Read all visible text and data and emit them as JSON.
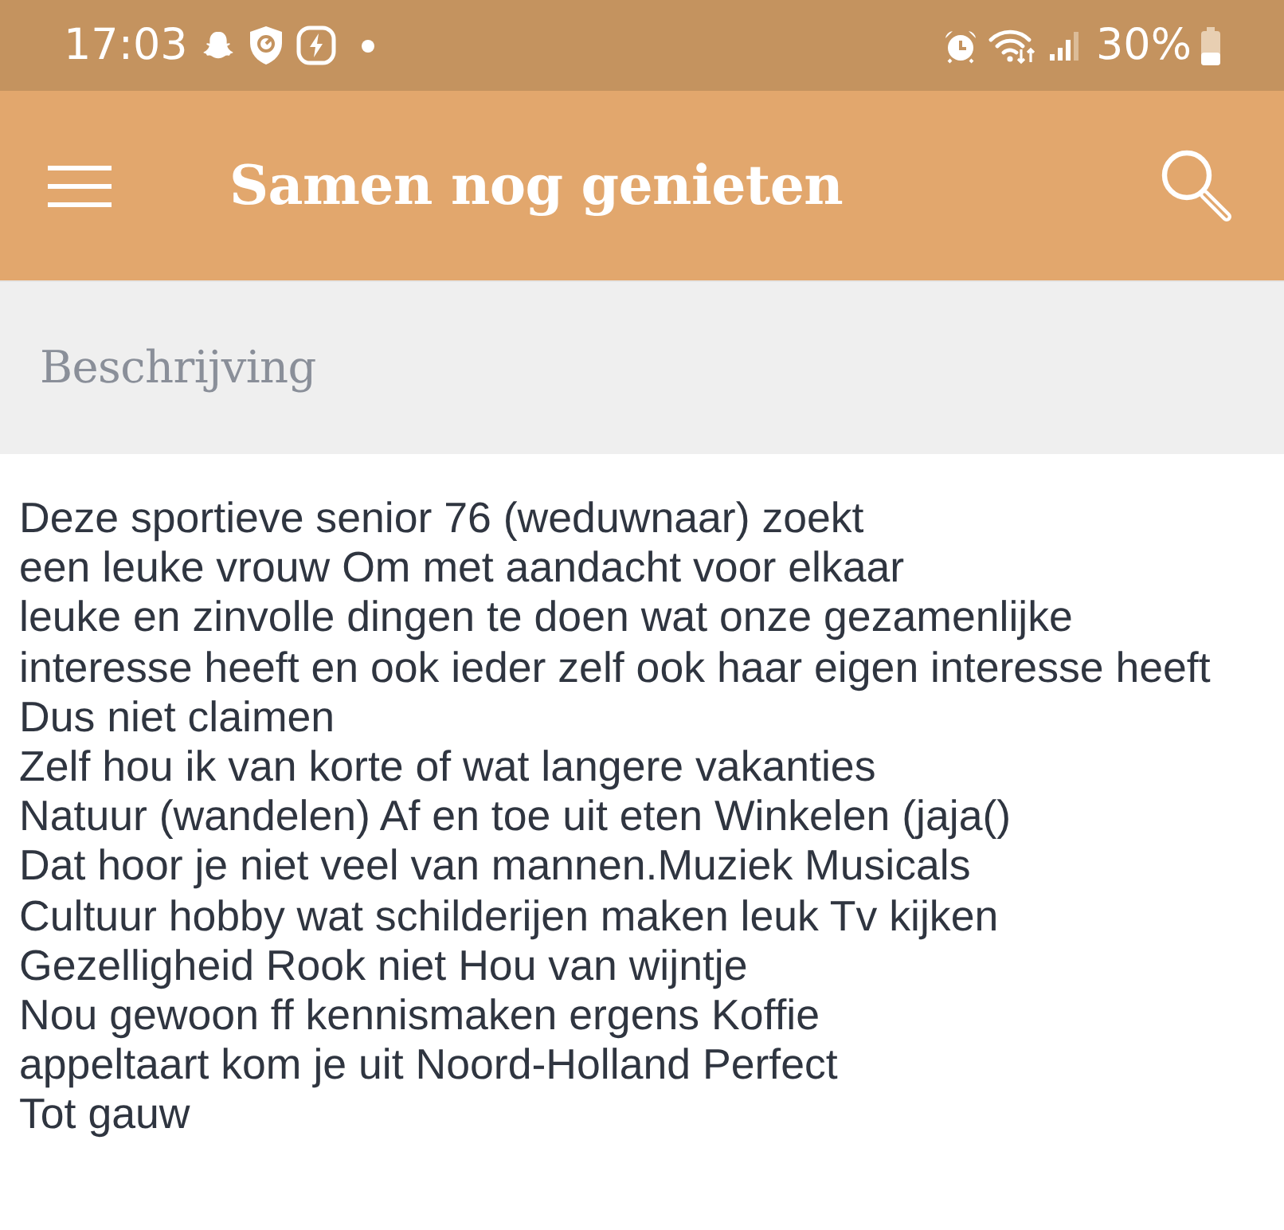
{
  "status_bar": {
    "time": "17:03",
    "battery": "30%"
  },
  "app_bar": {
    "title": "Samen nog genieten"
  },
  "section": {
    "heading": "Beschrijving"
  },
  "description": {
    "lines": [
      "Deze sportieve senior 76 (weduwnaar) zoekt",
      "een leuke vrouw Om met aandacht voor elkaar",
      "leuke en zinvolle dingen te doen wat onze gezamenlijke",
      "interesse heeft en ook ieder zelf ook haar eigen interesse heeft",
      "Dus niet claimen",
      "Zelf hou ik van korte of wat langere vakanties",
      "Natuur (wandelen) Af en toe uit eten Winkelen (jaja()",
      "Dat hoor je niet veel van mannen.Muziek Musicals",
      "Cultuur hobby wat schilderijen maken leuk Tv kijken",
      "Gezelligheid Rook niet Hou van wijntje",
      "Nou gewoon ff kennismaken ergens Koffie",
      "appeltaart kom je uit Noord-Holland Perfect",
      "Tot gauw"
    ]
  }
}
